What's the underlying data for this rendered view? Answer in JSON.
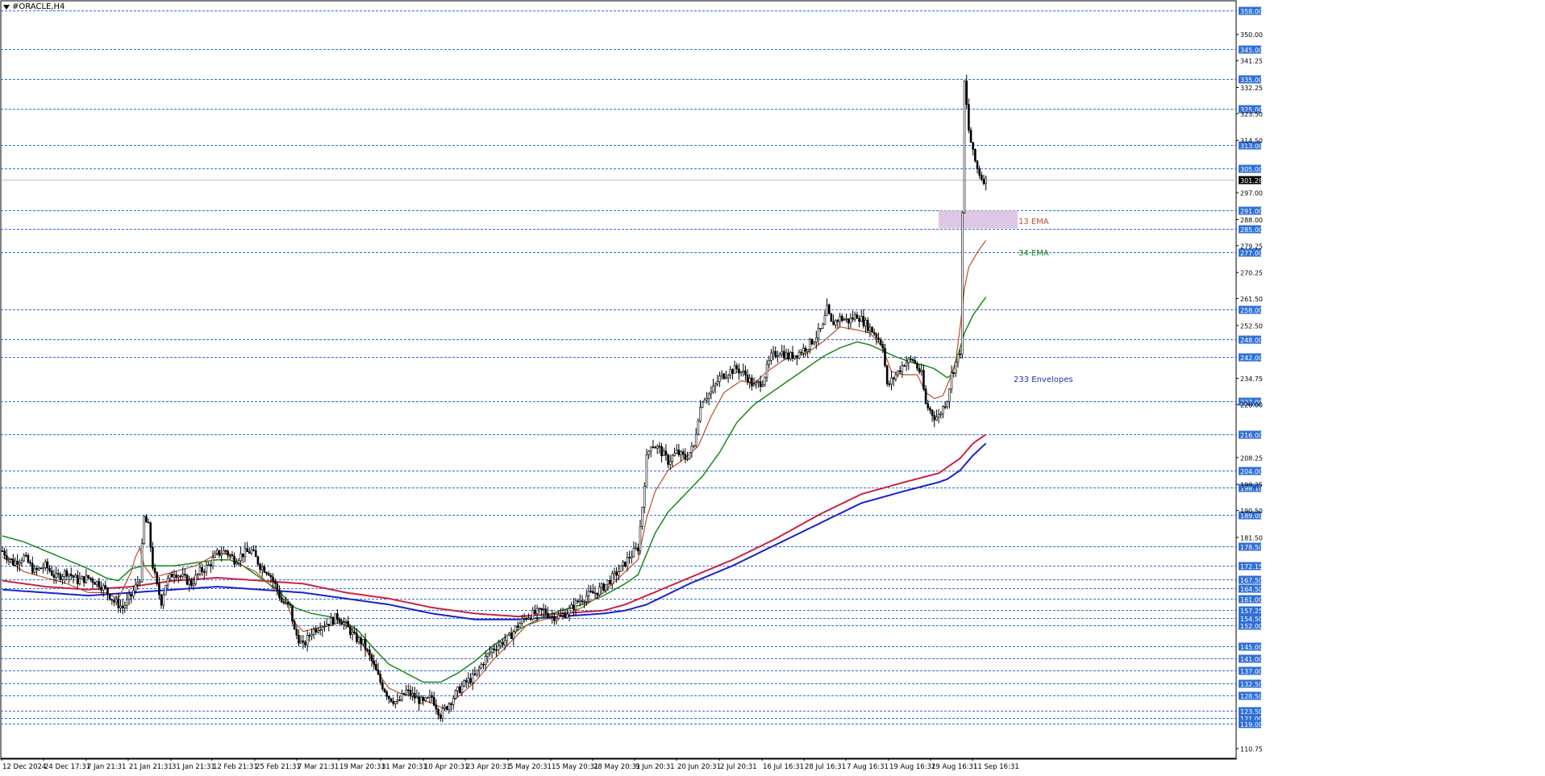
{
  "window": {
    "title": "#ORACLE,H4"
  },
  "colors": {
    "level_line": "#2f6fd8",
    "level_label_bg": "#2f6fd8",
    "price_label_bg": "#000000",
    "candle": "#000000",
    "ema13": "#b5532a",
    "ema34": "#1a8a1a",
    "env_upper": "#cc2244",
    "env_lower": "#1a22cc",
    "zone": "#d8bde0",
    "ema13_text": "#c0502a",
    "ema34_text": "#1a8a1a",
    "env_text": "#2233bb"
  },
  "annotations": {
    "ema13": "13 EMA",
    "ema34": "34 EMA",
    "envelopes": "233 Envelopes"
  },
  "chart_data": {
    "type": "candlestick",
    "symbol": "#ORACLE",
    "timeframe": "H4",
    "ylim": [
      107.5,
      361.0
    ],
    "current_price": "301.28",
    "zone": {
      "x_from": "29 Aug 16:31 +",
      "y_low": 285.0,
      "y_high": 291.0
    },
    "levels": [
      358.0,
      345.0,
      335.0,
      325.0,
      313.0,
      305.0,
      291.0,
      285.0,
      277.0,
      258.0,
      248.0,
      242.0,
      227.0,
      216.0,
      204.0,
      198.1,
      189.0,
      178.5,
      172.15,
      167.5,
      164.5,
      161.0,
      157.25,
      154.5,
      152.0,
      145.0,
      141.0,
      137.0,
      132.5,
      128.5,
      123.5,
      121.0,
      119.0
    ],
    "level_labels": [
      "358.00",
      "345.00",
      "335.00",
      "325.00",
      "313.00",
      "305.00",
      "291.00",
      "285.00",
      "277.00",
      "258.00",
      "248.00",
      "242.00",
      "227.00",
      "216.00",
      "204.00",
      "198.10",
      "189.00",
      "178.50",
      "172.15",
      "167.50",
      "164.50",
      "161.00",
      "157.25",
      "154.50",
      "152.00",
      "145.00",
      "141.00",
      "137.00",
      "132.50",
      "128.50",
      "123.50",
      "121.00",
      "119.00"
    ],
    "price_ticks": [
      "350.00",
      "341.25",
      "332.25",
      "323.50",
      "314.50",
      "297.00",
      "288.00",
      "279.25",
      "270.25",
      "261.50",
      "252.50",
      "234.75",
      "226.00",
      "208.25",
      "199.25",
      "190.50",
      "181.50",
      "110.75"
    ],
    "price_tick_values": [
      350.0,
      341.25,
      332.25,
      323.5,
      314.5,
      297.0,
      288.0,
      279.25,
      270.25,
      261.5,
      252.5,
      234.75,
      226.0,
      208.25,
      199.25,
      190.5,
      181.5,
      110.75
    ],
    "x_labels": [
      "12 Dec 2024",
      "24 Dec 17:31",
      "7 Jan 21:31",
      "21 Jan 21:31",
      "31 Jan 21:31",
      "12 Feb 21:31",
      "25 Feb 21:31",
      "7 Mar 21:31",
      "19 Mar 20:31",
      "31 Mar 20:31",
      "10 Apr 20:31",
      "23 Apr 20:31",
      "5 May 20:31",
      "15 May 20:31",
      "28 May 20:31",
      "9 Jun 20:31",
      "20 Jun 20:31",
      "2 Jul 20:31",
      "16 Jul 16:31",
      "28 Jul 16:31",
      "7 Aug 16:31",
      "19 Aug 16:31",
      "29 Aug 16:31",
      "11 Sep 16:31"
    ],
    "price_path": [
      [
        0,
        177
      ],
      [
        5,
        173
      ],
      [
        10,
        175
      ],
      [
        15,
        170
      ],
      [
        20,
        172
      ],
      [
        25,
        168
      ],
      [
        30,
        170
      ],
      [
        35,
        167
      ],
      [
        40,
        168
      ],
      [
        45,
        166
      ],
      [
        48,
        164
      ],
      [
        52,
        160
      ],
      [
        56,
        158
      ],
      [
        60,
        162
      ],
      [
        64,
        168
      ],
      [
        66,
        188
      ],
      [
        68,
        185
      ],
      [
        70,
        172
      ],
      [
        72,
        165
      ],
      [
        74,
        160
      ],
      [
        76,
        166
      ],
      [
        80,
        170
      ],
      [
        84,
        168
      ],
      [
        88,
        166
      ],
      [
        92,
        170
      ],
      [
        96,
        172
      ],
      [
        100,
        176
      ],
      [
        104,
        177
      ],
      [
        108,
        174
      ],
      [
        112,
        176
      ],
      [
        116,
        177
      ],
      [
        120,
        172
      ],
      [
        124,
        170
      ],
      [
        128,
        164
      ],
      [
        130,
        160
      ],
      [
        134,
        158
      ],
      [
        136,
        150
      ],
      [
        140,
        145
      ],
      [
        144,
        150
      ],
      [
        148,
        152
      ],
      [
        152,
        153
      ],
      [
        156,
        155
      ],
      [
        160,
        152
      ],
      [
        164,
        148
      ],
      [
        168,
        146
      ],
      [
        172,
        140
      ],
      [
        176,
        133
      ],
      [
        180,
        128
      ],
      [
        184,
        126
      ],
      [
        188,
        130
      ],
      [
        192,
        128
      ],
      [
        196,
        126
      ],
      [
        200,
        128
      ],
      [
        204,
        122
      ],
      [
        208,
        126
      ],
      [
        212,
        130
      ],
      [
        216,
        133
      ],
      [
        220,
        135
      ],
      [
        224,
        140
      ],
      [
        228,
        144
      ],
      [
        232,
        146
      ],
      [
        236,
        148
      ],
      [
        240,
        152
      ],
      [
        244,
        155
      ],
      [
        248,
        156
      ],
      [
        252,
        157
      ],
      [
        256,
        155
      ],
      [
        260,
        155
      ],
      [
        264,
        157
      ],
      [
        268,
        160
      ],
      [
        272,
        162
      ],
      [
        276,
        163
      ],
      [
        280,
        165
      ],
      [
        284,
        168
      ],
      [
        288,
        171
      ],
      [
        292,
        175
      ],
      [
        296,
        178
      ],
      [
        298,
        192
      ],
      [
        300,
        208
      ],
      [
        302,
        213
      ],
      [
        306,
        211
      ],
      [
        310,
        207
      ],
      [
        314,
        210
      ],
      [
        318,
        208
      ],
      [
        322,
        212
      ],
      [
        324,
        222
      ],
      [
        326,
        228
      ],
      [
        330,
        230
      ],
      [
        334,
        235
      ],
      [
        338,
        237
      ],
      [
        342,
        238
      ],
      [
        346,
        236
      ],
      [
        350,
        232
      ],
      [
        354,
        234
      ],
      [
        358,
        242
      ],
      [
        362,
        244
      ],
      [
        366,
        242
      ],
      [
        370,
        243
      ],
      [
        374,
        245
      ],
      [
        378,
        248
      ],
      [
        382,
        252
      ],
      [
        384,
        258
      ],
      [
        386,
        253
      ],
      [
        390,
        255
      ],
      [
        394,
        254
      ],
      [
        398,
        256
      ],
      [
        402,
        253
      ],
      [
        406,
        250
      ],
      [
        410,
        246
      ],
      [
        412,
        232
      ],
      [
        416,
        236
      ],
      [
        420,
        240
      ],
      [
        424,
        241
      ],
      [
        428,
        236
      ],
      [
        430,
        226
      ],
      [
        432,
        224
      ],
      [
        434,
        222
      ],
      [
        436,
        222
      ],
      [
        440,
        228
      ],
      [
        442,
        236
      ],
      [
        444,
        240
      ],
      [
        446,
        244
      ],
      [
        448,
        334
      ],
      [
        450,
        318
      ],
      [
        452,
        310
      ],
      [
        454,
        305
      ],
      [
        456,
        302
      ],
      [
        458,
        301
      ]
    ],
    "ema13_path": [
      [
        0,
        175
      ],
      [
        10,
        170
      ],
      [
        20,
        168
      ],
      [
        30,
        166
      ],
      [
        40,
        163
      ],
      [
        48,
        163
      ],
      [
        54,
        161
      ],
      [
        60,
        170
      ],
      [
        62,
        175
      ],
      [
        64,
        178
      ],
      [
        66,
        172
      ],
      [
        70,
        168
      ],
      [
        80,
        170
      ],
      [
        90,
        172
      ],
      [
        100,
        176
      ],
      [
        104,
        176
      ],
      [
        108,
        174
      ],
      [
        112,
        172
      ],
      [
        118,
        170
      ],
      [
        124,
        166
      ],
      [
        128,
        163
      ],
      [
        132,
        160
      ],
      [
        136,
        153
      ],
      [
        140,
        150
      ],
      [
        146,
        151
      ],
      [
        152,
        152
      ],
      [
        158,
        153
      ],
      [
        164,
        150
      ],
      [
        170,
        143
      ],
      [
        176,
        135
      ],
      [
        180,
        131
      ],
      [
        186,
        129
      ],
      [
        192,
        128
      ],
      [
        200,
        126
      ],
      [
        206,
        124
      ],
      [
        212,
        128
      ],
      [
        220,
        133
      ],
      [
        228,
        140
      ],
      [
        236,
        146
      ],
      [
        244,
        152
      ],
      [
        252,
        154
      ],
      [
        260,
        155
      ],
      [
        270,
        158
      ],
      [
        280,
        163
      ],
      [
        290,
        170
      ],
      [
        296,
        174
      ],
      [
        300,
        188
      ],
      [
        304,
        197
      ],
      [
        310,
        204
      ],
      [
        316,
        207
      ],
      [
        324,
        212
      ],
      [
        330,
        222
      ],
      [
        336,
        230
      ],
      [
        344,
        234
      ],
      [
        350,
        233
      ],
      [
        356,
        237
      ],
      [
        364,
        241
      ],
      [
        374,
        243
      ],
      [
        382,
        247
      ],
      [
        390,
        252
      ],
      [
        398,
        251
      ],
      [
        404,
        250
      ],
      [
        410,
        245
      ],
      [
        414,
        237
      ],
      [
        420,
        236
      ],
      [
        426,
        236
      ],
      [
        430,
        230
      ],
      [
        434,
        228
      ],
      [
        438,
        229
      ],
      [
        442,
        236
      ],
      [
        444,
        241
      ],
      [
        446,
        252
      ],
      [
        448,
        265
      ],
      [
        450,
        272
      ],
      [
        454,
        277
      ],
      [
        458,
        281
      ]
    ],
    "ema34_path": [
      [
        0,
        182
      ],
      [
        10,
        180
      ],
      [
        20,
        177
      ],
      [
        30,
        174
      ],
      [
        40,
        171
      ],
      [
        48,
        168
      ],
      [
        54,
        167
      ],
      [
        60,
        171
      ],
      [
        66,
        172
      ],
      [
        72,
        172
      ],
      [
        80,
        172
      ],
      [
        90,
        173
      ],
      [
        100,
        174
      ],
      [
        106,
        174
      ],
      [
        112,
        172
      ],
      [
        120,
        168
      ],
      [
        128,
        164
      ],
      [
        136,
        158
      ],
      [
        144,
        156
      ],
      [
        152,
        155
      ],
      [
        160,
        153
      ],
      [
        166,
        150
      ],
      [
        172,
        145
      ],
      [
        180,
        139
      ],
      [
        188,
        136
      ],
      [
        196,
        133
      ],
      [
        204,
        133
      ],
      [
        212,
        136
      ],
      [
        220,
        140
      ],
      [
        228,
        145
      ],
      [
        236,
        149
      ],
      [
        244,
        152
      ],
      [
        252,
        155
      ],
      [
        260,
        157
      ],
      [
        270,
        159
      ],
      [
        280,
        162
      ],
      [
        290,
        166
      ],
      [
        296,
        169
      ],
      [
        300,
        176
      ],
      [
        304,
        183
      ],
      [
        310,
        190
      ],
      [
        318,
        196
      ],
      [
        326,
        202
      ],
      [
        334,
        210
      ],
      [
        342,
        220
      ],
      [
        350,
        226
      ],
      [
        358,
        230
      ],
      [
        366,
        234
      ],
      [
        374,
        238
      ],
      [
        382,
        242
      ],
      [
        390,
        245
      ],
      [
        398,
        247
      ],
      [
        404,
        246
      ],
      [
        410,
        244
      ],
      [
        416,
        242
      ],
      [
        424,
        240
      ],
      [
        430,
        239
      ],
      [
        434,
        238
      ],
      [
        440,
        235
      ],
      [
        442,
        236
      ],
      [
        444,
        240
      ],
      [
        448,
        250
      ],
      [
        452,
        256
      ],
      [
        458,
        262
      ]
    ],
    "env_upper_path": [
      [
        0,
        167
      ],
      [
        20,
        165
      ],
      [
        40,
        164
      ],
      [
        60,
        165
      ],
      [
        80,
        167
      ],
      [
        100,
        168
      ],
      [
        120,
        167
      ],
      [
        140,
        166
      ],
      [
        160,
        163
      ],
      [
        180,
        161
      ],
      [
        200,
        158
      ],
      [
        220,
        156
      ],
      [
        240,
        155
      ],
      [
        260,
        156
      ],
      [
        280,
        157
      ],
      [
        290,
        159
      ],
      [
        300,
        162
      ],
      [
        320,
        168
      ],
      [
        340,
        174
      ],
      [
        360,
        181
      ],
      [
        380,
        189
      ],
      [
        400,
        196
      ],
      [
        420,
        200
      ],
      [
        436,
        203
      ],
      [
        440,
        205
      ],
      [
        446,
        208
      ],
      [
        452,
        213
      ],
      [
        458,
        216
      ]
    ],
    "env_lower_path": [
      [
        0,
        164
      ],
      [
        20,
        163
      ],
      [
        40,
        162
      ],
      [
        60,
        163
      ],
      [
        80,
        164
      ],
      [
        100,
        165
      ],
      [
        120,
        164
      ],
      [
        140,
        163
      ],
      [
        160,
        161
      ],
      [
        180,
        159
      ],
      [
        200,
        156
      ],
      [
        220,
        154
      ],
      [
        240,
        154
      ],
      [
        260,
        155
      ],
      [
        280,
        156
      ],
      [
        290,
        157
      ],
      [
        300,
        159
      ],
      [
        320,
        166
      ],
      [
        340,
        172
      ],
      [
        360,
        179
      ],
      [
        380,
        186
      ],
      [
        400,
        193
      ],
      [
        420,
        197
      ],
      [
        436,
        200
      ],
      [
        440,
        201
      ],
      [
        446,
        204
      ],
      [
        452,
        209
      ],
      [
        458,
        213
      ]
    ]
  }
}
